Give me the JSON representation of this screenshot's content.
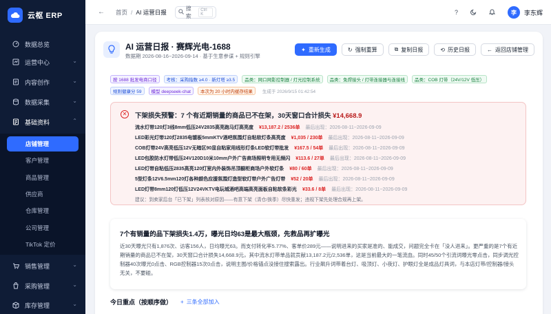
{
  "brand": {
    "name": "云枢 ERP"
  },
  "nav": {
    "dashboard": "数据总览",
    "operations": "运营中心",
    "content": "内容创作",
    "collection": "数据采集",
    "basic": "基础资料",
    "sub": [
      "店铺管理",
      "客户管理",
      "商品管理",
      "供应商",
      "仓库管理",
      "公司管理",
      "TikTok 定价"
    ],
    "sales": "销售管理",
    "purchase": "采购管理",
    "inventory": "库存管理"
  },
  "topbar": {
    "crumb_home": "首页",
    "crumb_sep": "/",
    "crumb_current": "AI 运营日报",
    "search_label": "搜索",
    "search_kbd": "Ctrl K",
    "help": "?",
    "user_initial": "李",
    "user_name": "李东辉"
  },
  "report": {
    "title": "AI 运营日报 · 赛辉光电-1688",
    "subtitle": "数据期 2026-08-16~2026-09-14 · 基于生意参谋 + 规则引擎",
    "actions": [
      "重新生成",
      "强制重算",
      "复制日报",
      "历史日报",
      "返回店铺管理"
    ],
    "tags_row1": [
      {
        "text": "按 1688 批发电商口径",
        "tone": "purple"
      },
      {
        "text": "考核：采购指数 ≥4.0 · 新灯塔 ≥3.5",
        "tone": "blue"
      },
      {
        "text": "品类：网口网影控制器 / 灯光控制系统",
        "tone": "green"
      },
      {
        "text": "品类：免焊接头 / 灯带连接器与连接线",
        "tone": "green"
      },
      {
        "text": "品类：COB 灯带（24V/12V 低压）",
        "tone": "green"
      }
    ],
    "tags_row2": [
      {
        "text": "规则健康分 59",
        "tone": "blue"
      },
      {
        "text": "模型 deepseek-chat",
        "tone": "purple"
      },
      {
        "text": "本次为 20 小时内缓存结果",
        "tone": "orange"
      }
    ],
    "generated_at": "生成于 2026/9/15 01:42:54"
  },
  "alert": {
    "title_prefix": "下架损失预警：7 个有近期销量的商品已不在架，30天窗口合计损失",
    "title_amount": "¥14,668.9",
    "rows": [
      {
        "name": "流水灯带120灯3线8mm低压24V2835高亮跑马灯高亮度",
        "loss": "¥13,187.2 / 2536单",
        "seen": "最后出现：2026-08-11~2026-09-09"
      },
      {
        "name": "LED彩光灯带120灯2835电镀板5mmKTV酒吧氛围灯自粘软灯条高亮度",
        "loss": "¥1,035 / 230单",
        "seen": "最后出现：2026-08-11~2026-09-09"
      },
      {
        "name": "COB灯带24V高亮低压12V无暗区90显自粘家用线形灯条LED软灯带批发",
        "loss": "¥167.5 / 54单",
        "seen": "最后出现：2026-08-11~2026-09-09"
      },
      {
        "name": "LED包胶防水灯带低压24V120D10米10mm户外广告商场照明专用无频闪",
        "loss": "¥113.6 / 27单",
        "seen": "最后出现：2026-08-11~2026-09-09"
      },
      {
        "name": "LED灯带自粘低压2835高亮120灯室内外装饰吊顶橱柜商场户外软灯条",
        "loss": "¥80 / 60单",
        "seen": "最后出现：2026-08-11~2026-09-09"
      },
      {
        "name": "5型灯条12V6.5mm120灯各种颜色应援氛围灯造型软灯带户外广告灯带",
        "loss": "¥52 / 20单",
        "seen": "最后出现：2026-08-11~2026-09-09"
      },
      {
        "name": "LED灯带8mm120灯低压12V24VKTV电玩城酒吧高端高亮面板自粘软条彩光",
        "loss": "¥33.6 / 8单",
        "seen": "最后出现：2026-08-11~2026-09-09"
      }
    ],
    "note": "建议：到卖家后台「已下架」列表核对原因——有意下架（清仓/换季）尽快重发；违规下架先处理合规再上架。"
  },
  "insight": {
    "title": "7个有销量的品下架损失1.4万，曝光日均63是最大瓶颈，先救品再扩曝光",
    "body": "近30天曝光只有1,876次、访客156人，日均曝光63。而支付转化率5.77%、客单价289元——说明进来的买家是准的、能成交，问题完全卡在「没人进来」。更严重的是7个有近期销量的商品已不在架，30天窗口合计损失14,668.9元，其中流水灯带单品就贡献13,187.2元/2,536单，这是当前最大的一笔流血。同时45/50个引流词曝光零点击，同步调光控制器40次曝光0点击、RGB控制器15次0点击，说明主图/价格锚点没接住搜索露出。行业飙升词带着台灯、吸顶灯、小夜灯、护眼灯全是成品灯具词，与本店灯带/控制器/接头无关，不要碰。"
  },
  "focus": {
    "title": "今日重点（按顺序做）",
    "link": "三条全部加入"
  },
  "colors": {
    "accent": "#2f6bff",
    "sidebar": "#0f1c36",
    "danger": "#dc2626"
  }
}
